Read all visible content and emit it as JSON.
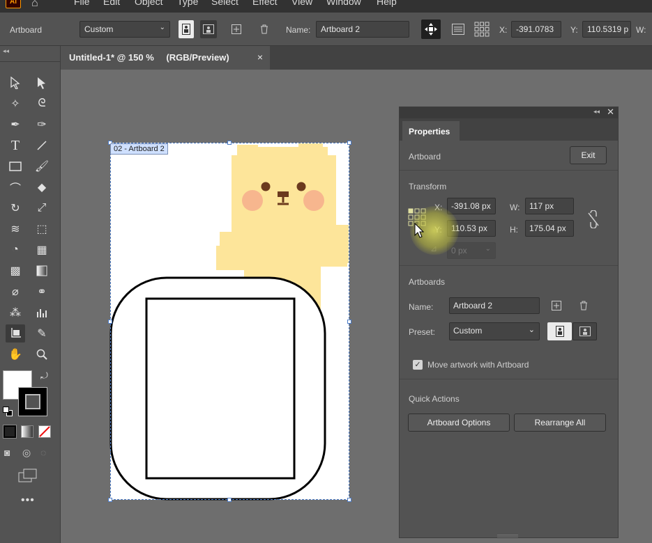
{
  "menubar": {
    "logo": "Ai",
    "items": [
      "File",
      "Edit",
      "Object",
      "Type",
      "Select",
      "Effect",
      "View",
      "Window",
      "Help"
    ]
  },
  "control_bar": {
    "mode_label": "Artboard",
    "preset_value": "Custom",
    "name_label": "Name:",
    "name_value": "Artboard 2",
    "x_label": "X:",
    "x_value": "-391.0783",
    "y_label": "Y:",
    "y_value": "110.5319 p",
    "w_label": "W:"
  },
  "document_tab": {
    "title": "Untitled-1* @ 150 %",
    "mode": "(RGB/Preview)",
    "close": "×"
  },
  "artboard": {
    "label": "02 - Artboard 2"
  },
  "properties": {
    "tab": "Properties",
    "section_artboard": "Artboard",
    "exit_button": "Exit",
    "section_transform": "Transform",
    "x_label": "X:",
    "x_value": "-391.08 px",
    "y_label": "Y:",
    "y_value": "110.53 px",
    "w_label": "W:",
    "w_value": "117 px",
    "h_label": "H:",
    "h_value": "175.04 px",
    "angle_value": "0 px",
    "section_artboards": "Artboards",
    "name_label": "Name:",
    "name_value": "Artboard 2",
    "preset_label": "Preset:",
    "preset_value": "Custom",
    "move_artwork_label": "Move artwork with Artboard",
    "section_quick_actions": "Quick Actions",
    "artboard_options_button": "Artboard Options",
    "rearrange_all_button": "Rearrange All"
  },
  "colors": {
    "bear_fill": "#fde59a",
    "bear_cheek": "#f7b68e",
    "bear_eye": "#6b3a1e",
    "accent_selection": "#4c7cc7"
  }
}
